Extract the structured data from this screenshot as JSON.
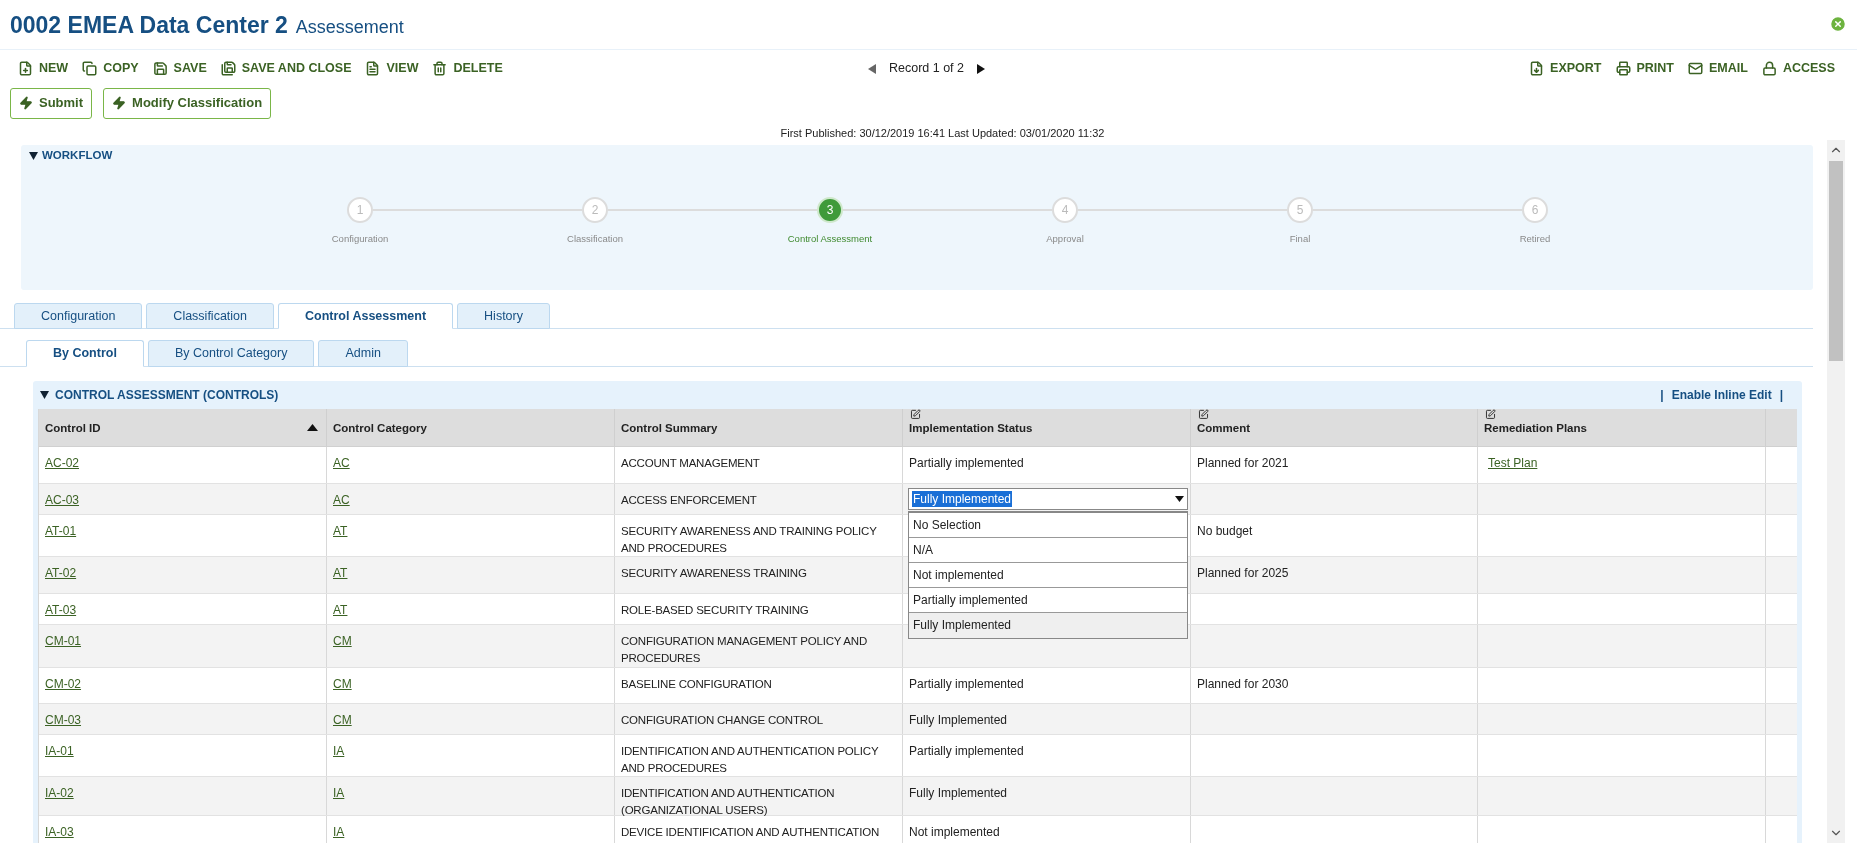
{
  "header": {
    "title": "0002 EMEA Data Center 2",
    "subtitle": "Assessement"
  },
  "toolbar": {
    "left": [
      {
        "kind": "new",
        "label": "NEW"
      },
      {
        "kind": "copy",
        "label": "COPY"
      },
      {
        "kind": "save",
        "label": "SAVE"
      },
      {
        "kind": "save_close",
        "label": "SAVE AND CLOSE"
      },
      {
        "kind": "view",
        "label": "VIEW"
      },
      {
        "kind": "delete",
        "label": "DELETE"
      }
    ],
    "pager": "Record 1 of 2",
    "right": [
      {
        "kind": "export",
        "label": "EXPORT"
      },
      {
        "kind": "print",
        "label": "PRINT"
      },
      {
        "kind": "email",
        "label": "EMAIL"
      },
      {
        "kind": "access",
        "label": "ACCESS"
      }
    ]
  },
  "actions": [
    "Submit",
    "Modify Classification"
  ],
  "published": "First Published: 30/12/2019 16:41 Last Updated: 03/01/2020 11:32",
  "workflow": {
    "title": "WORKFLOW",
    "steps": [
      {
        "number": "1",
        "label": "Configuration",
        "selected": false
      },
      {
        "number": "2",
        "label": "Classification",
        "selected": false
      },
      {
        "number": "3",
        "label": "Control Assessment",
        "selected": true
      },
      {
        "number": "4",
        "label": "Approval",
        "selected": false
      },
      {
        "number": "5",
        "label": "Final",
        "selected": false
      },
      {
        "number": "6",
        "label": "Retired",
        "selected": false
      }
    ]
  },
  "tabs": [
    {
      "label": "Configuration",
      "selected": false
    },
    {
      "label": "Classification",
      "selected": false
    },
    {
      "label": "Control Assessment",
      "selected": true
    },
    {
      "label": "History",
      "selected": false
    }
  ],
  "subtabs": [
    {
      "label": "By Control",
      "selected": true
    },
    {
      "label": "By Control Category",
      "selected": false
    },
    {
      "label": "Admin",
      "selected": false
    }
  ],
  "section": {
    "title": "CONTROL ASSESSMENT (CONTROLS)",
    "separator_left": "|",
    "link": "Enable Inline Edit",
    "separator_right": "|",
    "columns": [
      {
        "label": "Control ID",
        "editable": false,
        "sorted": true
      },
      {
        "label": "Control Category",
        "editable": false,
        "sorted": false
      },
      {
        "label": "Control Summary",
        "editable": false,
        "sorted": false
      },
      {
        "label": "Implementation Status",
        "editable": true,
        "sorted": false
      },
      {
        "label": "Comment",
        "editable": true,
        "sorted": false
      },
      {
        "label": "Remediation Plans",
        "editable": true,
        "sorted": false
      }
    ],
    "rows": [
      {
        "id": "AC-02",
        "category": "AC",
        "summary": "ACCOUNT MANAGEMENT",
        "status": "Partially implemented",
        "comment": "Planned for 2021",
        "plan": "Test Plan"
      },
      {
        "id": "AC-03",
        "category": "AC",
        "summary": "ACCESS ENFORCEMENT",
        "editor": {
          "value": "Fully Implemented",
          "options": [
            {
              "label": "No Selection",
              "selected": false
            },
            {
              "label": "N/A",
              "selected": false
            },
            {
              "label": "Not implemented",
              "selected": false
            },
            {
              "label": "Partially implemented",
              "selected": false
            },
            {
              "label": "Fully Implemented",
              "selected": true
            }
          ]
        }
      },
      {
        "id": "AT-01",
        "category": "AT",
        "summary": "SECURITY AWARENESS AND TRAINING POLICY AND PROCEDURES",
        "comment": "No budget"
      },
      {
        "id": "AT-02",
        "category": "AT",
        "summary": "SECURITY AWARENESS TRAINING",
        "comment": "Planned for 2025"
      },
      {
        "id": "AT-03",
        "category": "AT",
        "summary": "ROLE-BASED SECURITY TRAINING"
      },
      {
        "id": "CM-01",
        "category": "CM",
        "summary": "CONFIGURATION MANAGEMENT POLICY AND PROCEDURES"
      },
      {
        "id": "CM-02",
        "category": "CM",
        "summary": "BASELINE CONFIGURATION",
        "status": "Partially implemented",
        "comment": "Planned for 2030"
      },
      {
        "id": "CM-03",
        "category": "CM",
        "summary": "CONFIGURATION CHANGE CONTROL",
        "status": "Fully Implemented"
      },
      {
        "id": "IA-01",
        "category": "IA",
        "summary": "IDENTIFICATION AND AUTHENTICATION POLICY AND PROCEDURES",
        "status": "Partially implemented"
      },
      {
        "id": "IA-02",
        "category": "IA",
        "summary": "IDENTIFICATION AND AUTHENTICATION (ORGANIZATIONAL USERS)",
        "status": "Fully Implemented"
      },
      {
        "id": "IA-03",
        "category": "IA",
        "summary": "DEVICE IDENTIFICATION AND AUTHENTICATION",
        "status": "Not implemented"
      }
    ]
  }
}
